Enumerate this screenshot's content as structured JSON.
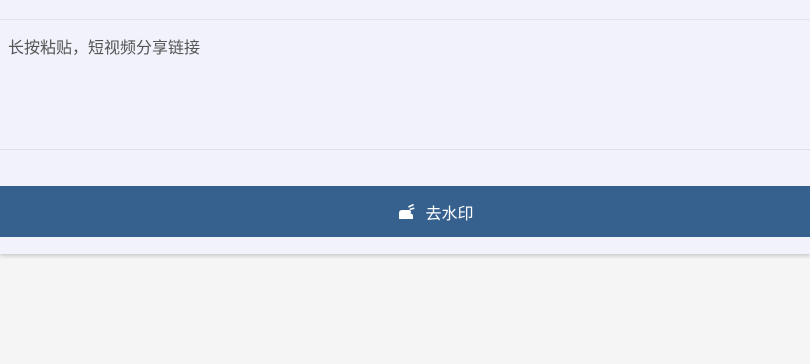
{
  "input": {
    "value": "",
    "placeholder": "长按粘贴，短视频分享链接"
  },
  "button": {
    "label": "去水印",
    "icon": "wipe-hand-icon",
    "background": "#36618e",
    "text_color": "#ffffff"
  },
  "colors": {
    "card_background": "#f1f2fb",
    "page_background": "#f5f5f5"
  }
}
